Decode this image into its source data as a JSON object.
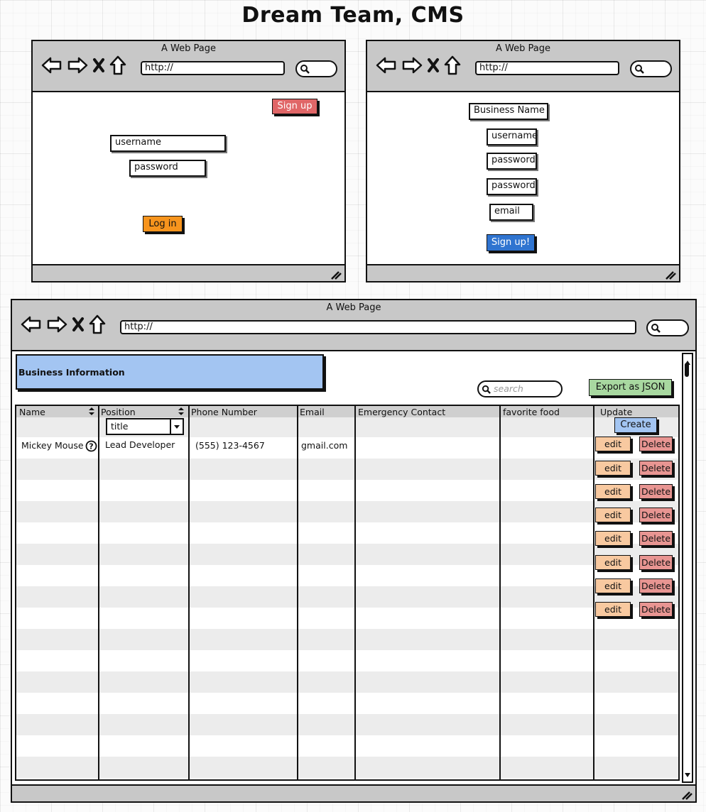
{
  "page_title": "Dream Team, CMS",
  "browser": {
    "title": "A Web Page",
    "url": "http://"
  },
  "login_page": {
    "signup_button": "Sign up",
    "username_field": "username",
    "password_field": "password",
    "login_button": "Log in"
  },
  "signup_page": {
    "business_name_field": "Business Name",
    "username_field": "username",
    "password_field": "password",
    "confirm_password_field": "password",
    "email_field": "email",
    "signup_button": "Sign up!"
  },
  "cms_page": {
    "panel_title": "Business Information",
    "search_placeholder": "search",
    "export_button": "Export as JSON",
    "columns": [
      "Name",
      "Position",
      "Phone Number",
      "Email",
      "Emergency Contact",
      "favorite food",
      "Update"
    ],
    "position_filter_value": "title",
    "create_button": "Create",
    "rows": [
      {
        "name": "Mickey Mouse",
        "position": "Lead Developer",
        "phone": "(555) 123-4567",
        "email": "gmail.com",
        "emergency_contact": "",
        "favorite_food": ""
      }
    ],
    "edit_label": "edit",
    "delete_label": "Delete"
  },
  "colors": {
    "signup_red": "#e06667",
    "login_orange": "#f7941d",
    "signup_blue": "#2f74d0",
    "panel_blue": "#a3c5f2",
    "export_green": "#a8d8a0",
    "create_blue": "#a3c5f2",
    "edit_orange": "#f8c9a0",
    "delete_red": "#e89592"
  },
  "icons": [
    "back-arrow-icon",
    "forward-arrow-icon",
    "stop-x-icon",
    "home-icon",
    "search-icon",
    "resize-grip-icon",
    "help-icon",
    "sort-arrows-icon",
    "dropdown-arrow-icon",
    "scroll-up-icon",
    "scroll-down-icon"
  ]
}
